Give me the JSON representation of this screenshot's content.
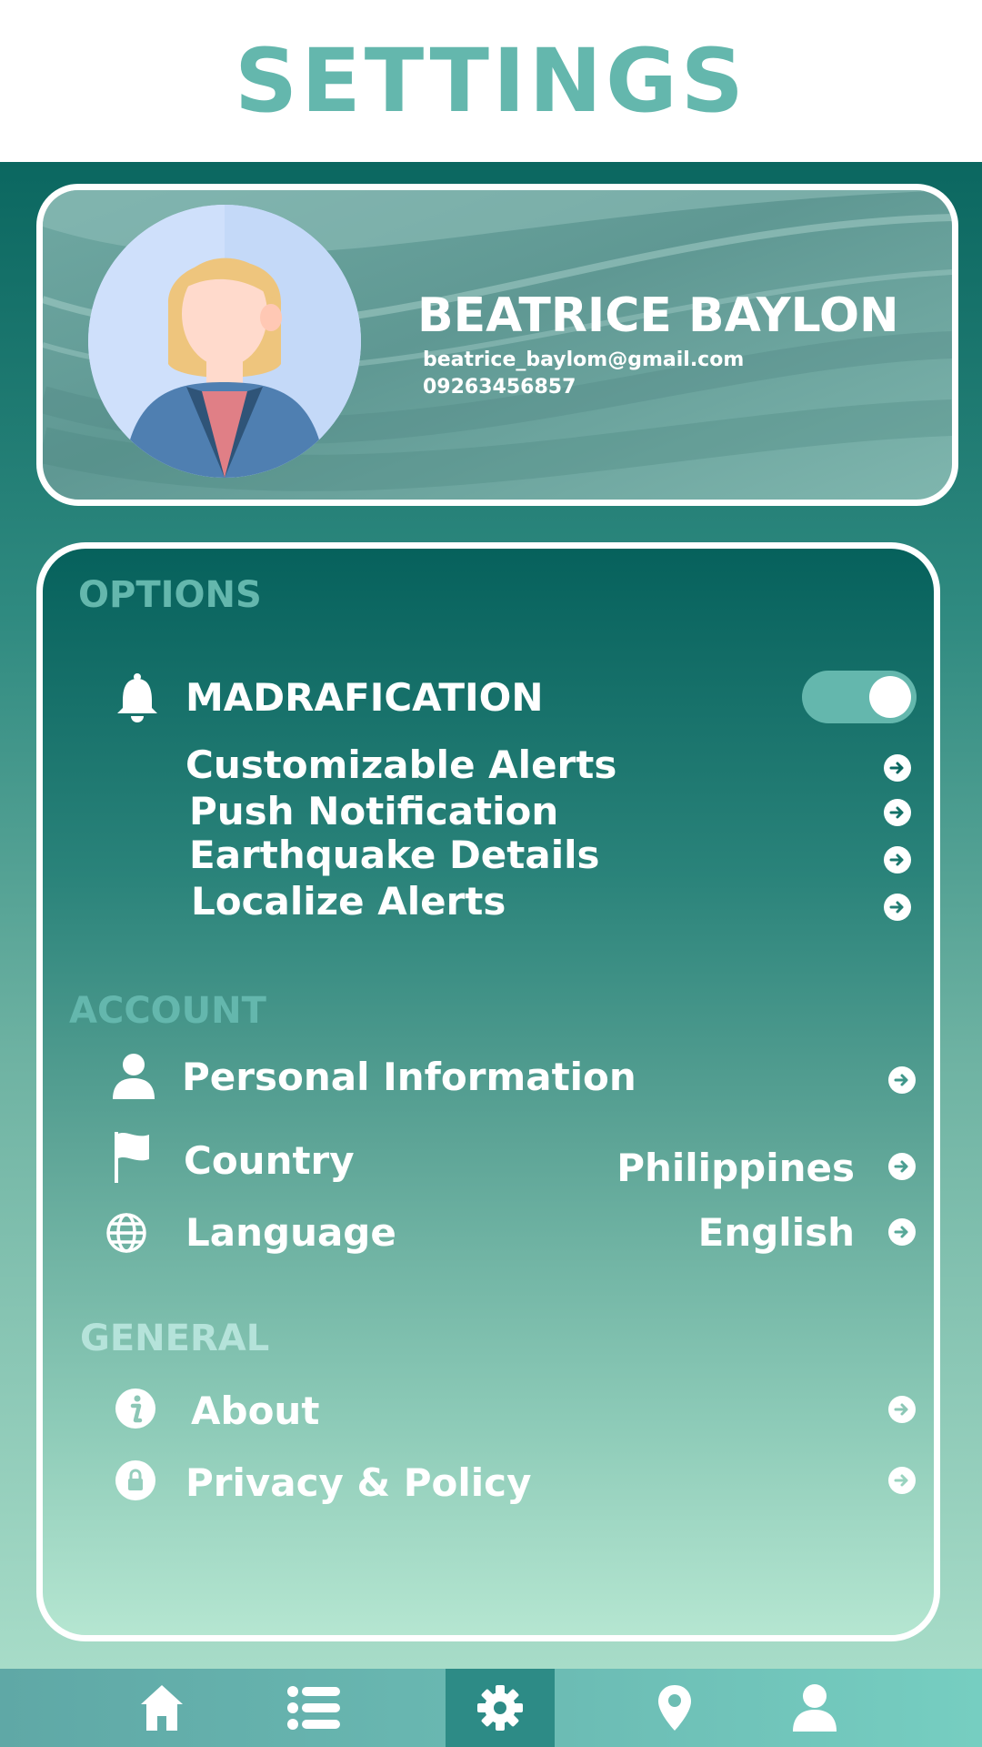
{
  "header": {
    "title": "SETTINGS"
  },
  "profile": {
    "name": "BEATRICE BAYLON",
    "email": "beatrice_baylom@gmail.com",
    "phone": "09263456857"
  },
  "options": {
    "section_label": "OPTIONS",
    "notification": {
      "label": "MADRAFICATION",
      "enabled": true,
      "icon": "bell-icon"
    },
    "items": [
      {
        "label": "Customizable Alerts"
      },
      {
        "label": "Push Notification"
      },
      {
        "label": "Earthquake Details"
      },
      {
        "label": "Localize Alerts"
      }
    ]
  },
  "account": {
    "section_label": "ACCOUNT",
    "personal_info": {
      "label": "Personal Information",
      "icon": "user-icon"
    },
    "country": {
      "label": "Country",
      "value": "Philippines",
      "icon": "flag-icon"
    },
    "language": {
      "label": "Language",
      "value": "English",
      "icon": "globe-icon"
    }
  },
  "general": {
    "section_label": "GENERAL",
    "about": {
      "label": "About",
      "icon": "info-icon"
    },
    "privacy": {
      "label": "Privacy & Policy",
      "icon": "lock-icon"
    }
  },
  "navbar": {
    "items": [
      "home-icon",
      "list-icon",
      "gear-icon",
      "location-pin-icon",
      "user-icon"
    ],
    "active": "gear-icon"
  },
  "colors": {
    "accent": "#64b7ad",
    "header_bg": "#ffffff",
    "card_top": "#06615c",
    "card_bottom": "#b5e6d1",
    "nav_active": "#2d8b86"
  }
}
